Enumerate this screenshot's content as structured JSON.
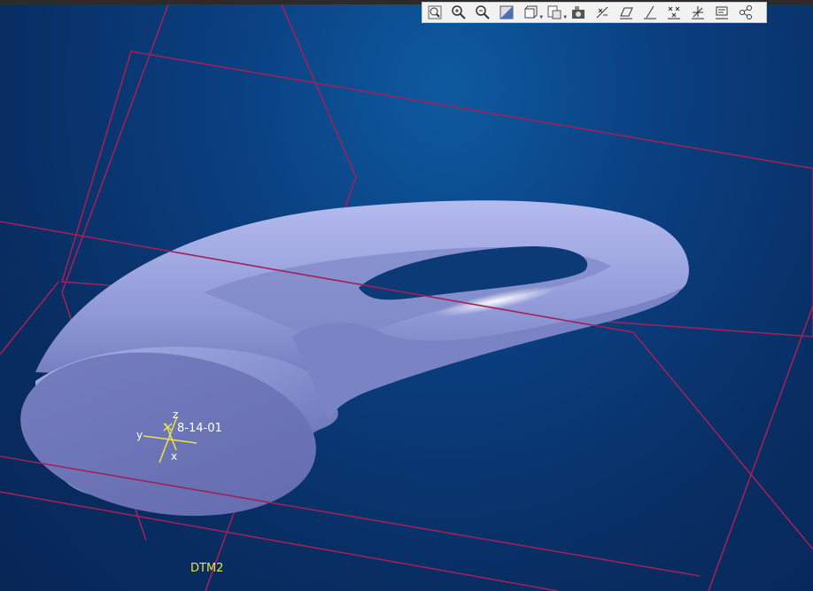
{
  "scene": {
    "background_color": "#0a3f80",
    "datum_color": "#a0205a",
    "part_color": "#8b95d4",
    "csys_color": "#e8e34a"
  },
  "labels": {
    "csys_name": "8-14-01",
    "datum_plane": "DTM2",
    "axis_x": "x",
    "axis_y": "y",
    "axis_z": "z"
  },
  "toolbar": {
    "items": [
      {
        "icon": "zoom-fit-icon"
      },
      {
        "icon": "zoom-in-icon"
      },
      {
        "icon": "zoom-out-icon"
      },
      {
        "icon": "repaint-icon"
      },
      {
        "icon": "display-style-icon"
      },
      {
        "icon": "saved-views-icon"
      },
      {
        "icon": "snapshot-icon"
      },
      {
        "icon": "datum-display-icon"
      },
      {
        "icon": "datum-planes-icon"
      },
      {
        "icon": "datum-axes-icon"
      },
      {
        "icon": "datum-points-icon"
      },
      {
        "icon": "coordinate-systems-icon"
      },
      {
        "icon": "annotations-icon"
      },
      {
        "icon": "spin-center-icon"
      }
    ]
  }
}
